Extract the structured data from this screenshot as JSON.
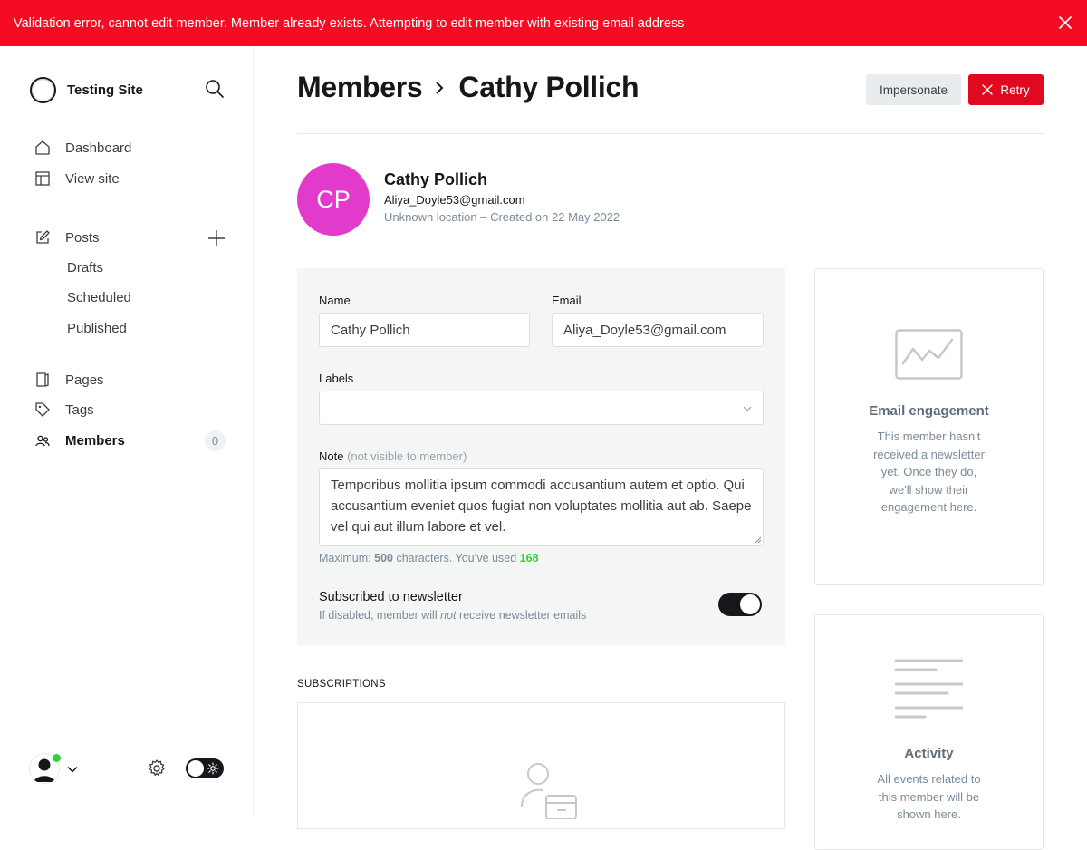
{
  "banner": {
    "message": "Validation error, cannot edit member. Member already exists. Attempting to edit member with existing email address"
  },
  "sidebar": {
    "site_name": "Testing Site",
    "items": [
      {
        "label": "Dashboard",
        "icon": "home-icon"
      },
      {
        "label": "View site",
        "icon": "layout-icon"
      },
      {
        "label": "Posts",
        "icon": "edit-icon"
      },
      {
        "label": "Pages",
        "icon": "page-icon"
      },
      {
        "label": "Tags",
        "icon": "tag-icon"
      },
      {
        "label": "Members",
        "icon": "members-icon",
        "active": true
      }
    ],
    "post_subitems": [
      "Drafts",
      "Scheduled",
      "Published"
    ],
    "members_count": "0"
  },
  "header": {
    "breadcrumb": "Members",
    "title": "Cathy Pollich",
    "impersonate_label": "Impersonate",
    "retry_label": "Retry"
  },
  "member": {
    "initials": "CP",
    "name": "Cathy Pollich",
    "email": "Aliya_Doyle53@gmail.com",
    "meta": "Unknown location – Created on 22 May 2022"
  },
  "form": {
    "name_label": "Name",
    "name_value": "Cathy Pollich",
    "email_label": "Email",
    "email_value": "Aliya_Doyle53@gmail.com",
    "labels_label": "Labels",
    "note_label": "Note",
    "note_hint": "(not visible to member)",
    "note_value": "Temporibus mollitia ipsum commodi accusantium autem et optio. Qui accusantium eveniet quos fugiat non voluptates mollitia aut ab. Saepe vel qui aut illum labore et vel.",
    "char_prefix": "Maximum: ",
    "char_max": "500",
    "char_mid": " characters. You’ve used ",
    "char_used": "168",
    "newsletter_title": "Subscribed to newsletter",
    "newsletter_desc_a": "If disabled, member will ",
    "newsletter_desc_em": "not",
    "newsletter_desc_b": " receive newsletter emails",
    "newsletter_on": true
  },
  "subscriptions": {
    "heading": "SUBSCRIPTIONS"
  },
  "engagement_card": {
    "title": "Email engagement",
    "text": "This member hasn't received a newsletter yet. Once they do, we'll show their engagement here."
  },
  "activity_card": {
    "title": "Activity",
    "text": "All events related to this member will be shown here."
  },
  "colors": {
    "banner": "#f50b23",
    "retry": "#e0091f",
    "avatar": "#e23bcc",
    "online": "#30cf43"
  }
}
